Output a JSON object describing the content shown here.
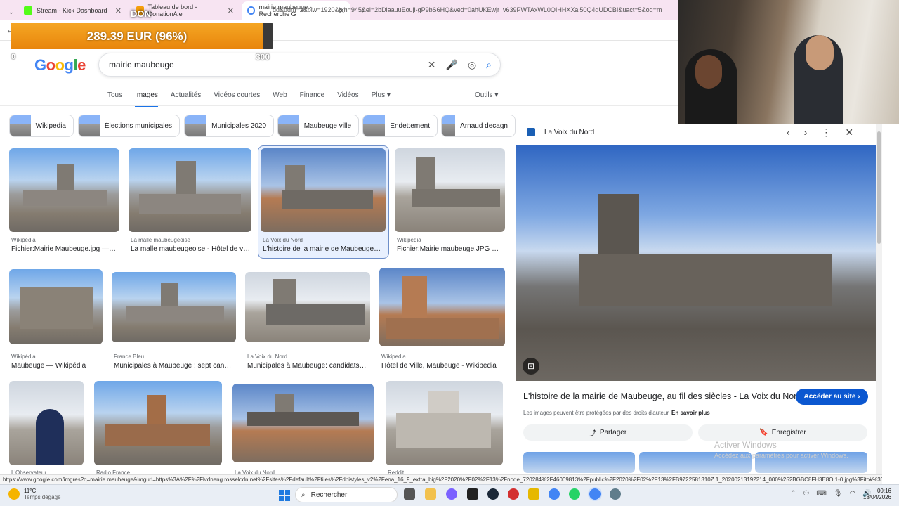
{
  "browser": {
    "tabs": [
      {
        "label": "Stream - Kick Dashboard",
        "color": "#53fc18"
      },
      {
        "label": "Tableau de bord - DonationAle",
        "color": "#f59e0b"
      },
      {
        "label": "mairie maubeuge - Recherche G",
        "color": "#4285f4"
      }
    ],
    "new_tab": "+",
    "url": "dd&udm=2&biw=1920&bih=945&ei=2bDiaauuEouji-gP9bS6HQ&ved=0ahUKEwjr_v639PWTAxWL0QIHHXXal50Q4dUDCBI&uact=5&oq=m"
  },
  "donation": {
    "label": "DON",
    "amount": "289.39 EUR (96%)",
    "min": "0",
    "max": "300",
    "progress": 0.96
  },
  "google": {
    "logo": "Google",
    "query": "mairie maubeuge",
    "nav_tabs": [
      "Tous",
      "Images",
      "Actualités",
      "Vidéos courtes",
      "Web",
      "Finance",
      "Vidéos",
      "Plus ▾"
    ],
    "selected_tab": "Images",
    "tools": "Outils ▾",
    "chips": [
      "Wikipedia",
      "Élections municipales",
      "Municipales 2020",
      "Maubeuge ville",
      "Endettement",
      "Arnaud decagn"
    ]
  },
  "results": [
    {
      "source": "Wikipédia",
      "title": "Fichier:Mairie Maubeuge.jpg — ..."
    },
    {
      "source": "La malle maubeugeoise",
      "title": "La malle maubeugeoise - Hôtel de ville"
    },
    {
      "source": "La Voix du Nord",
      "title": "L'histoire de la mairie de Maubeuge, ..."
    },
    {
      "source": "Wikipédia",
      "title": "Fichier:Mairie maubeuge.JPG — ..."
    },
    {
      "source": "Wikipédia",
      "title": "Maubeuge — Wikipédia"
    },
    {
      "source": "France Bleu",
      "title": "Municipales à Maubeuge : sept candi..."
    },
    {
      "source": "La Voix du Nord",
      "title": "Municipales à Maubeuge: candidats, ..."
    },
    {
      "source": "Wikipedia",
      "title": "Hôtel de Ville, Maubeuge - Wikipedia"
    },
    {
      "source": "L'Observateur",
      "title": ""
    },
    {
      "source": "Radio France",
      "title": ""
    },
    {
      "source": "La Voix du Nord",
      "title": ""
    },
    {
      "source": "Reddit",
      "title": ""
    }
  ],
  "panel": {
    "source": "La Voix du Nord",
    "title": "L'histoire de la mairie de Maubeuge, au fil des siècles - La Voix du Nord",
    "visit": "Accéder au site ›",
    "copyright": "Les images peuvent être protégées par des droits d'auteur.",
    "learn_more": "En savoir plus",
    "share": "Partager",
    "save": "Enregistrer",
    "lens": "⊡"
  },
  "watermark": {
    "line1": "Activer Windows",
    "line2": "Accédez aux paramètres pour activer Windows."
  },
  "status_url": "https://www.google.com/imgres?q=mairie maubeuge&imgurl=https%3A%2F%2Flvdneng.rosselcdn.net%2Fsites%2Fdefault%2Ffiles%2Fdpistyles_v2%2Fena_16_9_extra_big%2F2020%2F02%2F13%2Fnode_720284%2F46009813%2Fpublic%2F2020%2F02%2F13%2FB9722581310Z.1_20200213192214_000%252BGBC8FH3E8O.1-0.jpg%3Fitok%3D0fz2gSbY158...",
  "taskbar": {
    "temp": "11°C",
    "weather": "Temps dégagé",
    "search": "Rechercher",
    "time": "00:16",
    "date": "18/04/2026"
  }
}
